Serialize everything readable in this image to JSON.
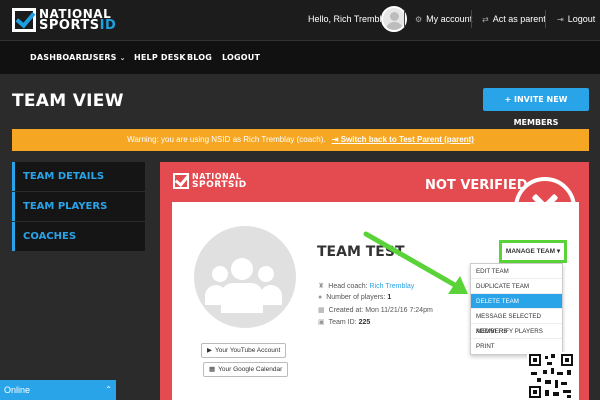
{
  "header": {
    "logo_line1": "NATIONAL",
    "logo_line2": "SPORTS",
    "logo_suffix": "ID",
    "greeting": "Hello, Rich Tremblay",
    "links": [
      {
        "label": "My account",
        "icon": "gear-icon"
      },
      {
        "label": "Act as parent",
        "icon": "switch-icon"
      },
      {
        "label": "Logout",
        "icon": "logout-icon"
      }
    ]
  },
  "nav": {
    "items": [
      "DASHBOARD",
      "USERS",
      "HELP DESK",
      "BLOG",
      "LOGOUT"
    ]
  },
  "page": {
    "title": "TEAM VIEW",
    "invite_label": "+ INVITE NEW MEMBERS"
  },
  "warning": {
    "text": "Warning: you are using NSID as Rich Tremblay (coach).",
    "switch_label": "Switch back to Test Parent (parent)"
  },
  "sidebar": {
    "items": [
      {
        "label": "TEAM DETAILS"
      },
      {
        "label": "TEAM PLAYERS"
      },
      {
        "label": "COACHES"
      }
    ]
  },
  "team": {
    "card_logo_line1": "NATIONAL",
    "card_logo_line2": "SPORTSID",
    "status": "NOT VERIFIED",
    "name": "TEAM TEST",
    "manage_label": "MANAGE TEAM",
    "head_coach_label": "Head coach:",
    "head_coach": "Rich Tremblay",
    "players_label": "Number of players:",
    "players": "1",
    "created_label": "Created at:",
    "created": "Mon 11/21/16 7:24pm",
    "team_id_label": "Team ID:",
    "team_id": "225",
    "youtube_label": "Your YouTube Account",
    "calendar_label": "Your Google Calendar"
  },
  "manage_menu": {
    "items": [
      "EDIT TEAM",
      "DUPLICATE TEAM",
      "DELETE TEAM",
      "MESSAGE SELECTED MEMBERS",
      "ADD/VERIFY PLAYERS",
      "PRINT"
    ],
    "active_index": 2
  },
  "chat": {
    "status": "Online"
  },
  "colors": {
    "accent": "#2aa4e8",
    "warning": "#f5a623",
    "danger": "#e34b50",
    "highlight": "#5ad339"
  }
}
